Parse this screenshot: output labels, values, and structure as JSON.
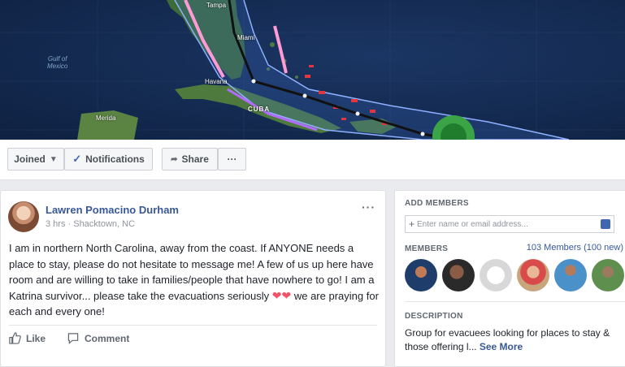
{
  "cover_map": {
    "labels": {
      "tampa": "Tampa",
      "miami": "Miami",
      "gulf": "Gulf of\nMexico",
      "havana": "Havana",
      "cuba": "CUBA",
      "merida": "Merida"
    }
  },
  "action_bar": {
    "joined_label": "Joined",
    "notifications_label": "Notifications",
    "share_label": "Share",
    "more_label": "···"
  },
  "post": {
    "author": "Lawren Pomacino Durham",
    "meta": "3 hrs · Shacktown, NC",
    "more_label": "···",
    "text": "I am in northern North Carolina, away from the coast. If ANYONE needs a place to stay, please do not hesitate to message me! A few of us up here have room and are willing to take in families/people that have nowhere to go! I am a Katrina survivor... please take the evacuations seriously",
    "text_end": "we are praying for each and every one!",
    "emoji": "❤❤",
    "like_label": "Like",
    "comment_label": "Comment"
  },
  "sidebar": {
    "add_members_heading": "ADD MEMBERS",
    "add_members_placeholder": "Enter name or email address...",
    "members_heading": "MEMBERS",
    "members_count": "103 Members (100 new)",
    "description_heading": "DESCRIPTION",
    "description_text": "Group for evacuees looking for places to stay & those offering l...",
    "see_more_label": "See More"
  },
  "colors": {
    "link_blue": "#385898",
    "fb_blue": "#4267b2",
    "heart_red": "#f25268",
    "map_ocean": "#142a4f",
    "storm_track": "#111111"
  }
}
